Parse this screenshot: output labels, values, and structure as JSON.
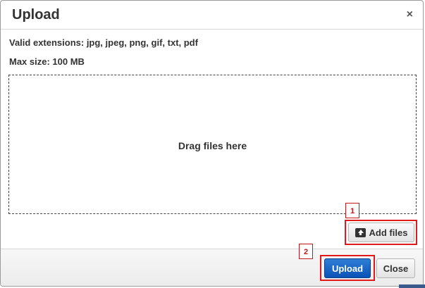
{
  "dialog": {
    "title": "Upload",
    "close_glyph": "×",
    "valid_extensions": "Valid extensions: jpg, jpeg, png, gif, txt, pdf",
    "max_size": "Max size: 100 MB",
    "dropzone_text": "Drag files here",
    "add_files_label": "Add files",
    "upload_label": "Upload",
    "close_label": "Close",
    "marker_1": "1",
    "marker_2": "2"
  },
  "colors": {
    "primary_button": "#0a52b7",
    "marker": "#e01a1a"
  },
  "icons": {
    "add_files_icon": "upload-icon",
    "close_icon": "close-icon"
  }
}
